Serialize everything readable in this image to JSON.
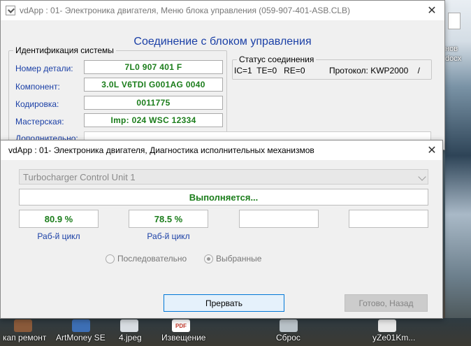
{
  "desktop": {
    "right_labels": [
      "нов",
      "docx"
    ],
    "bottom_icons": [
      "кап ремонт",
      "ArtMoney SE",
      "4.jpeg",
      "Извещение",
      "Сброс",
      "yZe01Km..."
    ],
    "pdf_badge": "PDF"
  },
  "main_window": {
    "title": "vdApp : 01- Электроника двигателя,  Меню блока управления (059-907-401-ASB.CLB)",
    "close_label": "✕",
    "heading": "Соединение с блоком управления",
    "ident_group_label": "Идентификация системы",
    "fields": [
      {
        "label": "Номер детали:",
        "value": "7L0 907 401 F"
      },
      {
        "label": "Компонент:",
        "value": "3.0L V6TDI  G001AG  0040"
      },
      {
        "label": "Кодировка:",
        "value": "0011775"
      },
      {
        "label": "Мастерская:",
        "value": "Imp: 024    WSC 12334"
      },
      {
        "label": "Дополнительно:",
        "value": ""
      }
    ],
    "status_group_label": "Статус соединения",
    "status_counters": "IC=1  TE=0   RE=0",
    "protocol": "Протокол: KWP2000    /"
  },
  "dialog": {
    "title": "vdApp : 01- Электроника двигателя,  Диагностика исполнительных механизмов",
    "close_label": "✕",
    "selected_unit": "Turbocharger Control Unit 1",
    "status": "Выполняется...",
    "values": [
      {
        "value": "80.9 %",
        "label": "Раб-й цикл"
      },
      {
        "value": "78.5 %",
        "label": "Раб-й цикл"
      },
      {
        "value": "",
        "label": ""
      },
      {
        "value": "",
        "label": ""
      }
    ],
    "radio_sequential": "Последовательно",
    "radio_selected": "Выбранные",
    "abort_button": "Прервать",
    "done_button": "Готово, Назад"
  },
  "colors": {
    "accent_blue": "#1a3fa6",
    "value_green": "#1b7d1b",
    "primary_button_border": "#0078d7"
  }
}
